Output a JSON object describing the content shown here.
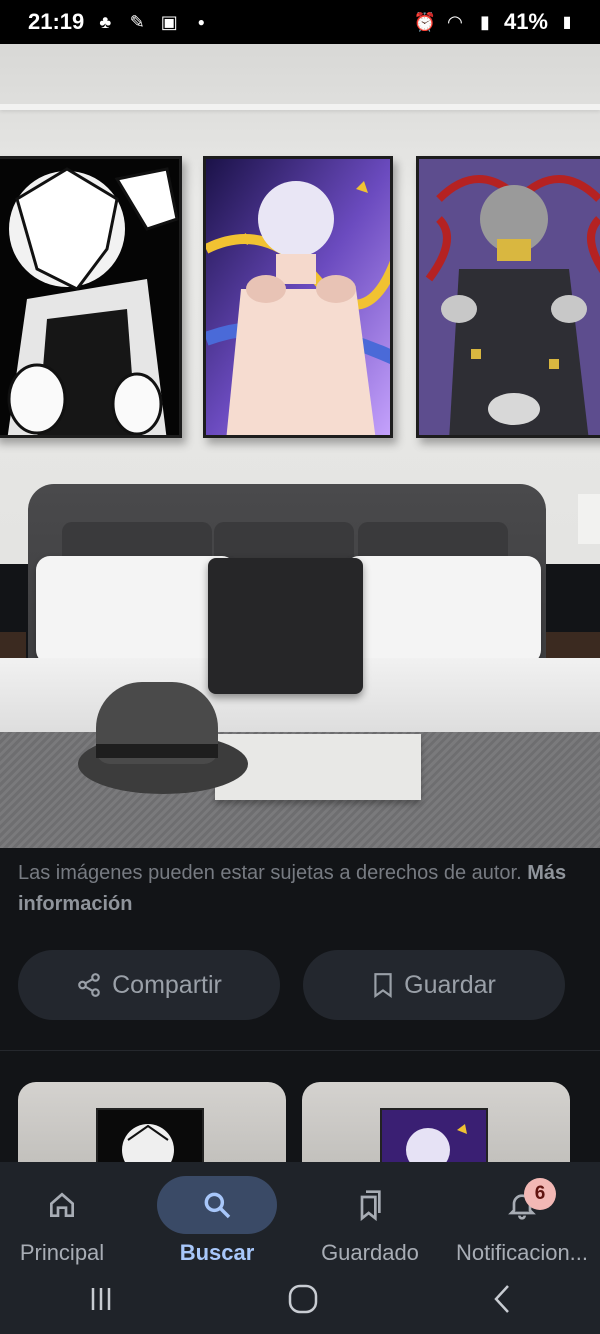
{
  "status_bar": {
    "time": "21:19",
    "left_icons": [
      "palm-tree-icon",
      "carrot-icon",
      "image-icon",
      "dot-icon"
    ],
    "right_icons": [
      "alarm-icon",
      "wifi-icon",
      "signal-icon"
    ],
    "battery": "41%"
  },
  "image": {
    "description_icon": "bedroom-posters-image"
  },
  "copyright": {
    "text": "Las imágenes pueden estar sujetas a derechos de autor.",
    "link": "Más información"
  },
  "actions": {
    "share_label": "Compartir",
    "save_label": "Guardar"
  },
  "bottom_nav": {
    "items": [
      {
        "label": "Principal",
        "icon": "home-icon"
      },
      {
        "label": "Buscar",
        "icon": "search-icon"
      },
      {
        "label": "Guardado",
        "icon": "bookmarks-icon"
      },
      {
        "label": "Notificacion...",
        "icon": "bell-icon"
      }
    ],
    "badge": "6"
  },
  "colors": {
    "background": "#121417",
    "active_tab": "#3a4a66",
    "active_text": "#a8c7fa",
    "badge": "#f2b8b5"
  }
}
